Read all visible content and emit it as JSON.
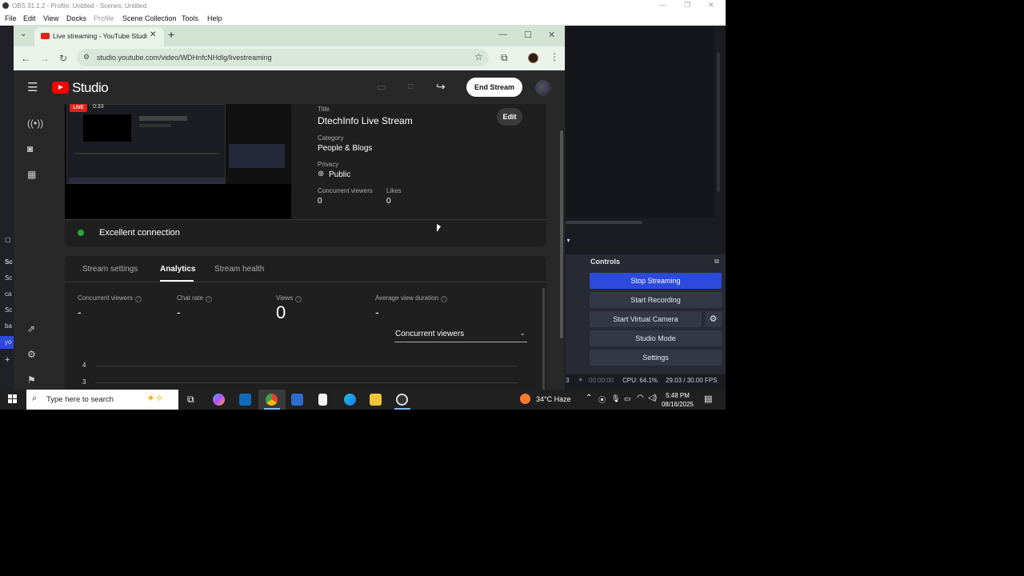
{
  "obs": {
    "title": "OBS 31.1.2 - Profile: Untitled - Scenes: Untitled",
    "menu": [
      "File",
      "Edit",
      "View",
      "Docks",
      "Profile",
      "Scene Collection",
      "Tools",
      "Help"
    ],
    "left_items": [
      "Sc",
      "Sc",
      "ca",
      "Sc",
      "ba",
      "yo"
    ],
    "controls_title": "Controls",
    "controls": {
      "stop_streaming": "Stop Streaming",
      "start_recording": "Start Recording",
      "start_virtual_camera": "Start Virtual Camera",
      "studio_mode": "Studio Mode",
      "settings": "Settings"
    },
    "status": {
      "left_num": "3",
      "rec_time": "00:00:00",
      "cpu": "CPU: 64.1%",
      "fps": "29.03 / 30.00 FPS"
    },
    "colors": {
      "accent": "#2c4bdb"
    }
  },
  "browser": {
    "tab_title": "Live streaming - YouTube Studio",
    "url": "studio.youtube.com/video/WDHnfcNHdlg/livestreaming"
  },
  "studio": {
    "brand": "Studio",
    "end_stream": "End Stream",
    "live_badge": "LIVE",
    "live_time": "0:33",
    "title_label": "Title",
    "title_value": "DtechInfo Live Stream",
    "edit": "Edit",
    "category_label": "Category",
    "category_value": "People & Blogs",
    "privacy_label": "Privacy",
    "privacy_value": "Public",
    "concurrent_label": "Concurrent viewers",
    "concurrent_value": "0",
    "likes_label": "Likes",
    "likes_value": "0",
    "connection": "Excellent connection",
    "tabs": [
      "Stream settings",
      "Analytics",
      "Stream health"
    ],
    "metrics": [
      {
        "label": "Concurrent viewers",
        "value": "-"
      },
      {
        "label": "Chat rate",
        "value": "-"
      },
      {
        "label": "Views",
        "value": "0"
      },
      {
        "label": "Average view duration",
        "value": "-"
      }
    ],
    "dropdown": "Concurrent viewers",
    "y_ticks": [
      "4",
      "3"
    ],
    "colors": {
      "live": "#e62117",
      "good": "#2ba640"
    }
  },
  "taskbar": {
    "search_placeholder": "Type here to search",
    "weather": "34°C  Haze",
    "time": "5:48 PM",
    "date": "08/16/2025"
  }
}
